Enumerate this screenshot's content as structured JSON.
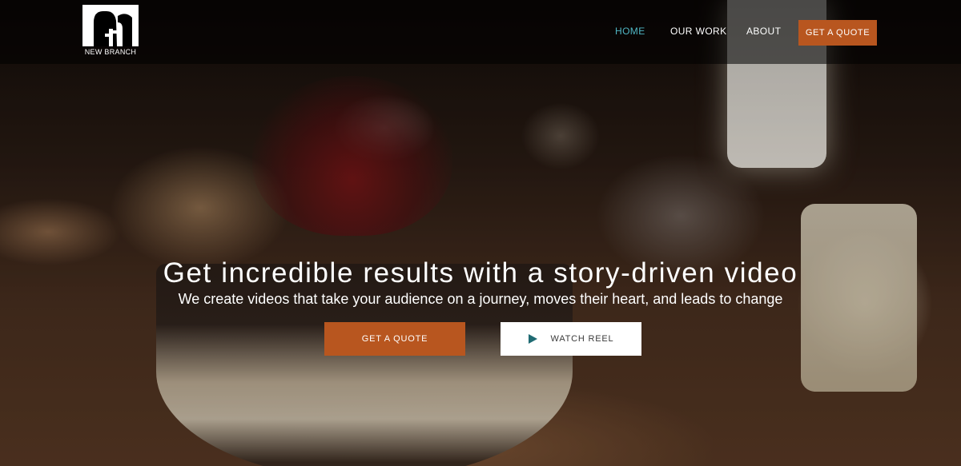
{
  "brand": {
    "name": "NEW BRANCH",
    "accent_color": "#b8561f",
    "active_link_color": "#4fb6c4"
  },
  "nav": {
    "items": [
      {
        "label": "HOME",
        "active": true
      },
      {
        "label": "OUR WORK",
        "active": false
      },
      {
        "label": "ABOUT",
        "active": false
      }
    ],
    "cta_label": "GET A QUOTE"
  },
  "hero": {
    "headline": "Get incredible results with a story-driven video",
    "subheadline": "We create videos that take your audience on a journey, moves their heart, and leads to change",
    "primary_button": "GET A QUOTE",
    "secondary_button": "WATCH REEL",
    "secondary_button_icon": "play-icon"
  }
}
